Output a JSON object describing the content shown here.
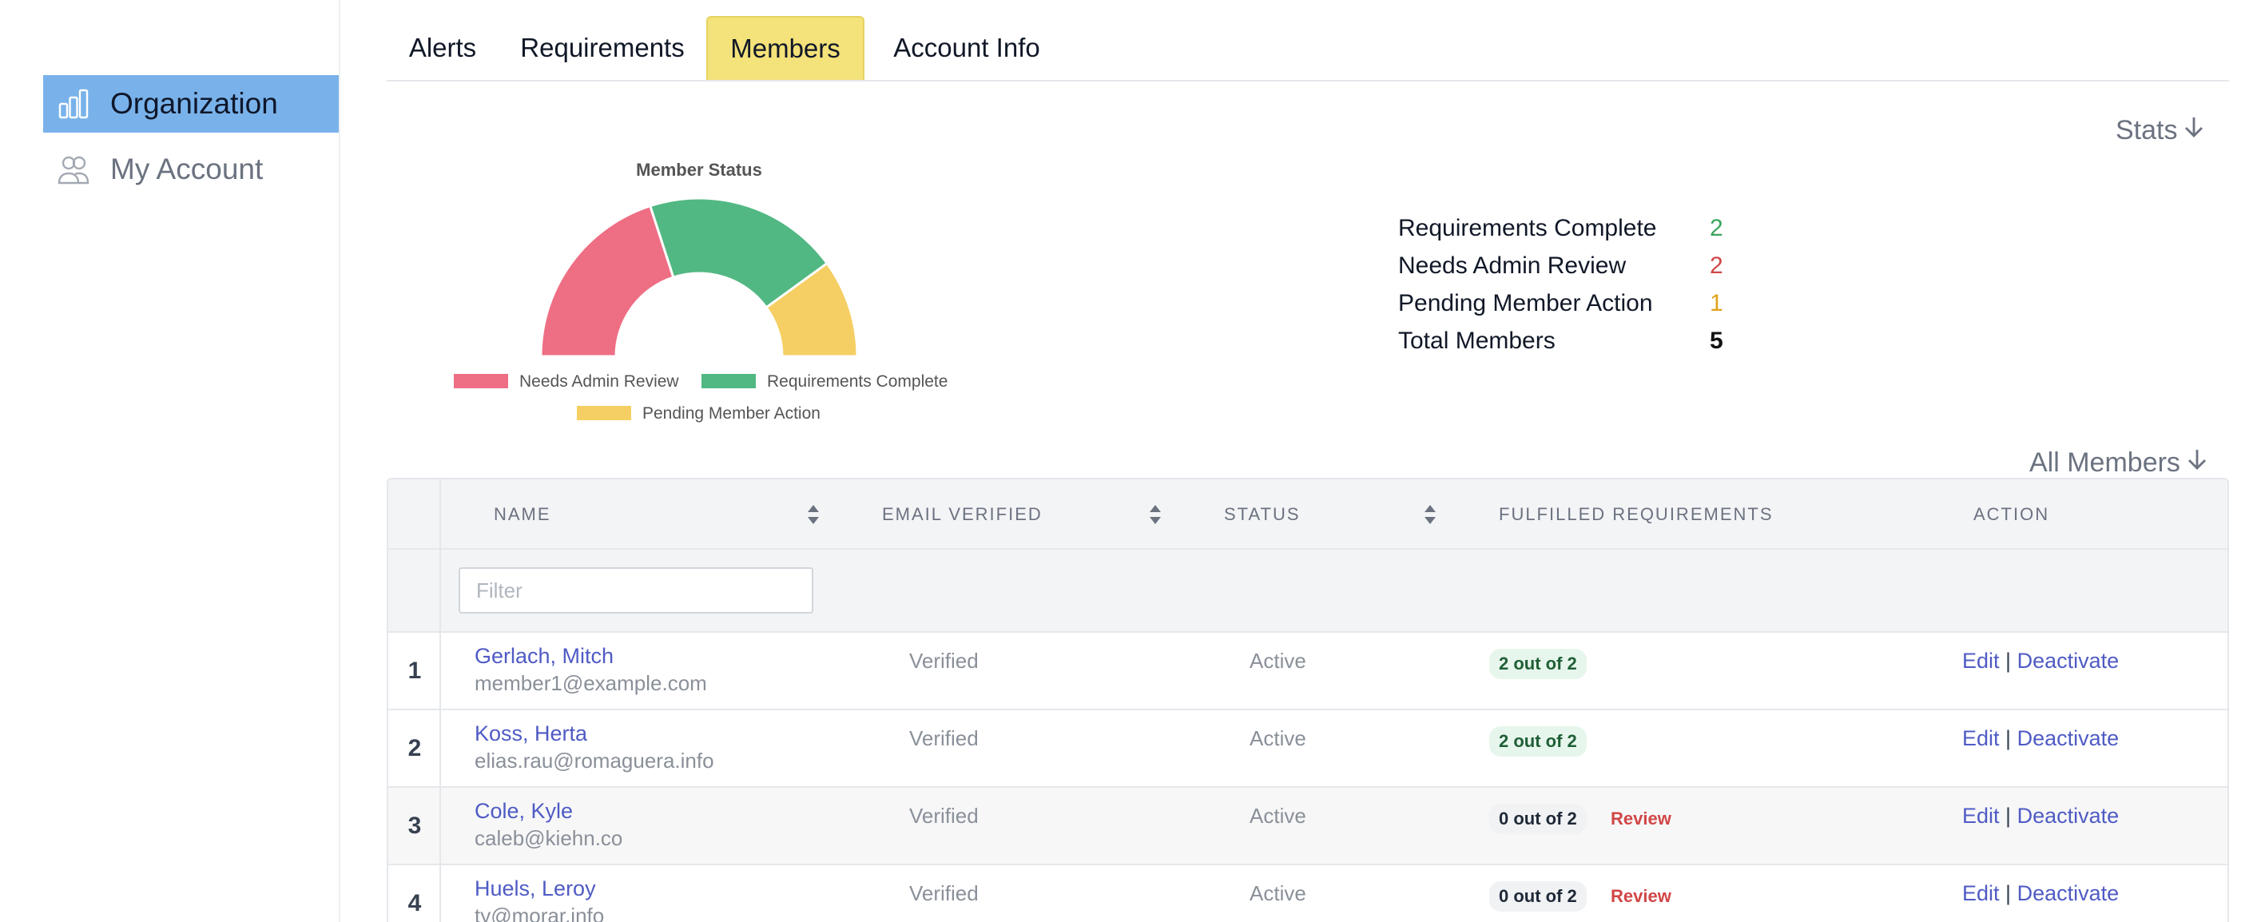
{
  "sidebar": {
    "items": [
      {
        "label": "Organization",
        "icon": "bar-chart-icon",
        "active": true
      },
      {
        "label": "My Account",
        "icon": "users-icon",
        "active": false
      }
    ]
  },
  "tabs": [
    {
      "label": "Alerts"
    },
    {
      "label": "Requirements"
    },
    {
      "label": "Members",
      "active": true
    },
    {
      "label": "Account Info"
    }
  ],
  "stats_link": "Stats",
  "all_members_link": "All Members",
  "chart_data": {
    "type": "pie",
    "variant": "half-doughnut",
    "title": "Member Status",
    "labels": [
      "Needs Admin Review",
      "Requirements Complete",
      "Pending Member Action"
    ],
    "values": [
      2,
      2,
      1
    ],
    "colors": [
      "#ee6e84",
      "#52b883",
      "#f5cf63"
    ],
    "legend": "bottom"
  },
  "stats": [
    {
      "label": "Requirements Complete",
      "value": "2",
      "color": "#3aa55c"
    },
    {
      "label": "Needs Admin Review",
      "value": "2",
      "color": "#d14646"
    },
    {
      "label": "Pending Member Action",
      "value": "1",
      "color": "#e0a21a"
    },
    {
      "label": "Total Members",
      "value": "5",
      "color": "#111111"
    }
  ],
  "table": {
    "headers": {
      "name": "NAME",
      "email_verified": "EMAIL VERIFIED",
      "status": "STATUS",
      "fulfilled": "FULFILLED REQUIREMENTS",
      "action": "ACTION"
    },
    "filter_placeholder": "Filter",
    "edit_label": "Edit",
    "separator": "|",
    "deactivate_label": "Deactivate",
    "rows": [
      {
        "num": "1",
        "name": "Gerlach, Mitch",
        "email": "member1@example.com",
        "verified": "Verified",
        "status": "Active",
        "fulfilled": "2 out of 2",
        "review": ""
      },
      {
        "num": "2",
        "name": "Koss, Herta",
        "email": "elias.rau@romaguera.info",
        "verified": "Verified",
        "status": "Active",
        "fulfilled": "2 out of 2",
        "review": ""
      },
      {
        "num": "3",
        "name": "Cole, Kyle",
        "email": "caleb@kiehn.co",
        "verified": "Verified",
        "status": "Active",
        "fulfilled": "0 out of 2",
        "review": "Review"
      },
      {
        "num": "4",
        "name": "Huels, Leroy",
        "email": "ty@morar.info",
        "verified": "Verified",
        "status": "Active",
        "fulfilled": "0 out of 2",
        "review": "Review"
      }
    ]
  }
}
